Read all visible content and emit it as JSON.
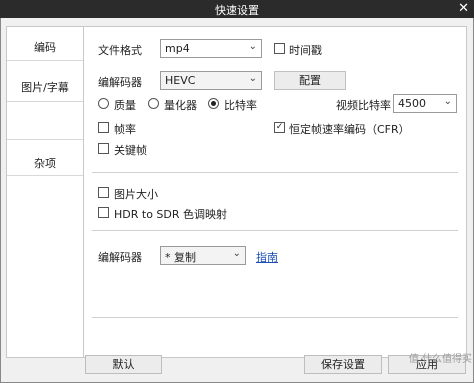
{
  "window": {
    "title": "快速设置",
    "close_glyph": "✕"
  },
  "sidebar": {
    "tabs": [
      {
        "label": "编码",
        "active": true
      },
      {
        "label": "图片/字幕",
        "active": false
      },
      {
        "label": "杂项",
        "active": false
      }
    ]
  },
  "format": {
    "label": "文件格式",
    "value": "mp4",
    "timestamp_label": "时间戳",
    "timestamp_checked": false
  },
  "video": {
    "codec_label": "编解码器",
    "codec_value": "HEVC",
    "config_button": "配置",
    "rate_modes": [
      {
        "label": "质量",
        "selected": false
      },
      {
        "label": "量化器",
        "selected": false
      },
      {
        "label": "比特率",
        "selected": true
      }
    ],
    "bitrate_label": "视频比特率",
    "bitrate_value": "4500",
    "framerate_label": "帧率",
    "framerate_checked": false,
    "keyframe_label": "关键帧",
    "keyframe_checked": false,
    "cfr_label": "恒定帧速率编码（CFR）",
    "cfr_checked": true
  },
  "image": {
    "size_label": "图片大小",
    "size_checked": false,
    "hdr_label": "HDR to SDR 色调映射",
    "hdr_checked": false
  },
  "audio": {
    "codec_label": "编解码器",
    "codec_value": "* 复制",
    "guide_link": "指南"
  },
  "footer": {
    "default_button": "默认",
    "save_button": "保存设置",
    "apply_button": "应用"
  },
  "watermark": "值 什么值得买"
}
